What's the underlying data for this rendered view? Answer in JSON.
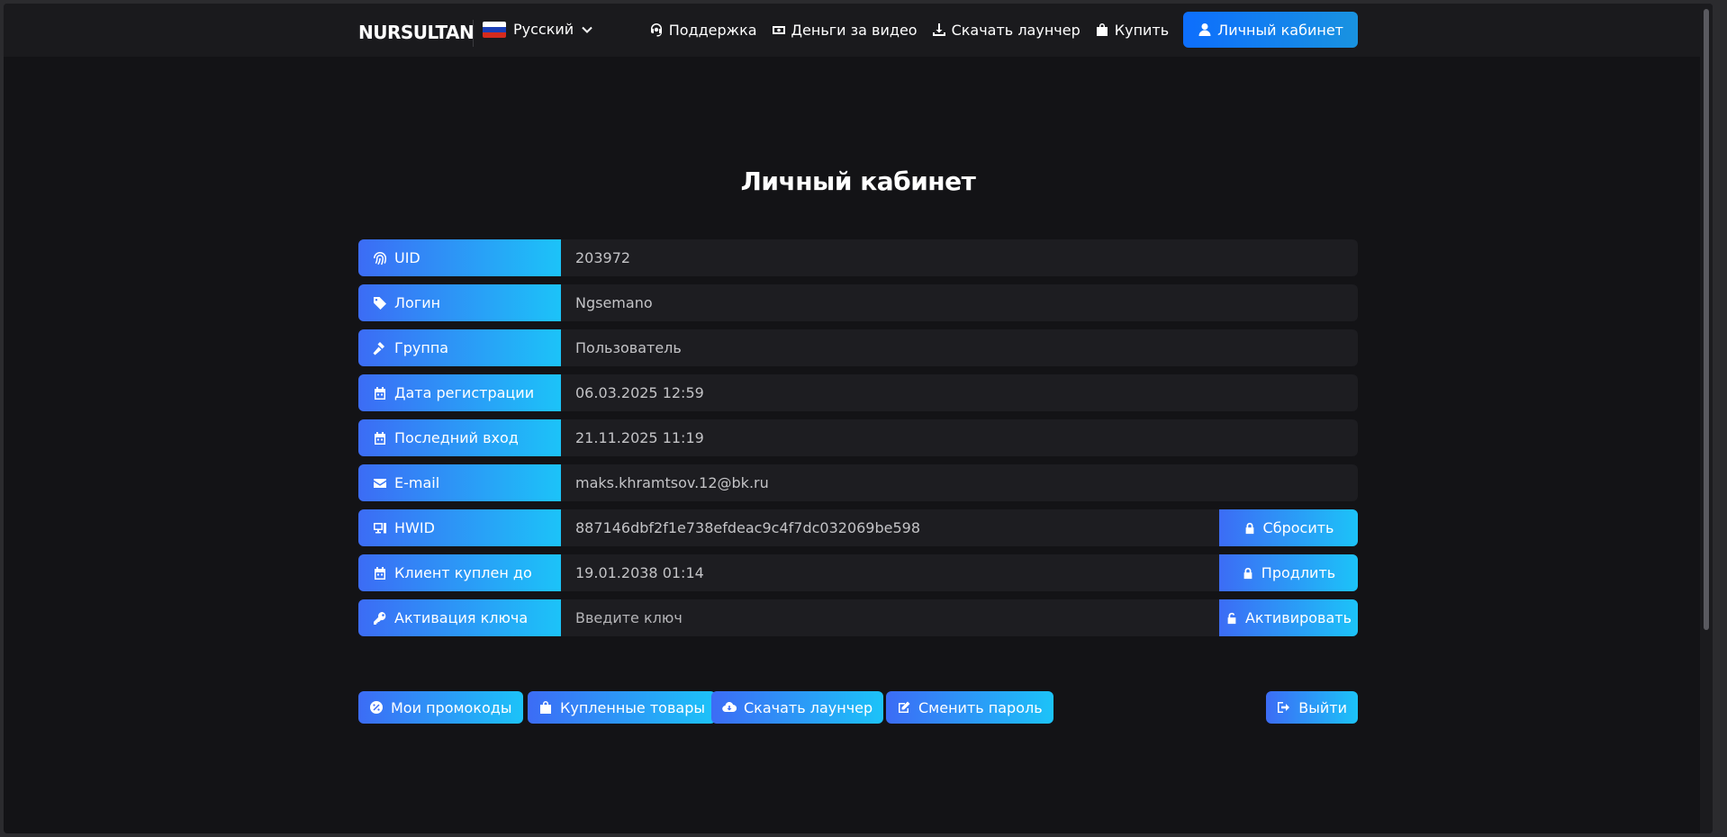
{
  "header": {
    "brand": "NURSULTAN",
    "language": "Русский",
    "nav": {
      "support": "Поддержка",
      "money_for_video": "Деньги за видео",
      "download_launcher": "Скачать лаунчер",
      "buy": "Купить",
      "cabinet": "Личный кабинет"
    }
  },
  "page_title": "Личный кабинет",
  "profile": {
    "uid": {
      "label": "UID",
      "value": "203972"
    },
    "login": {
      "label": "Логин",
      "value": "Ngsemano"
    },
    "group": {
      "label": "Группа",
      "value": "Пользователь"
    },
    "reg_date": {
      "label": "Дата регистрации",
      "value": "06.03.2025 12:59"
    },
    "last_login": {
      "label": "Последний вход",
      "value": "21.11.2025 11:19"
    },
    "email": {
      "label": "E-mail",
      "value": "maks.khramtsov.12@bk.ru"
    },
    "hwid": {
      "label": "HWID",
      "value": "887146dbf2f1e738efdeac9c4f7dc032069be598",
      "action": "Сбросить"
    },
    "client_until": {
      "label": "Клиент куплен до",
      "value": "19.01.2038 01:14",
      "action": "Продлить"
    },
    "key_activation": {
      "label": "Активация ключа",
      "placeholder": "Введите ключ",
      "action": "Активировать"
    }
  },
  "bottom_buttons": {
    "promocodes": "Мои промокоды",
    "purchased": "Купленные товары",
    "download_launcher": "Скачать лаунчер",
    "change_password": "Сменить пароль",
    "logout": "Выйти"
  },
  "colors": {
    "background": "#131316",
    "topbar": "#1a1a1d",
    "row_background": "#1d1d21",
    "gradient_start": "#3c6cf5",
    "gradient_end": "#1cc3f8",
    "cabinet_button": "#0d6efd"
  }
}
